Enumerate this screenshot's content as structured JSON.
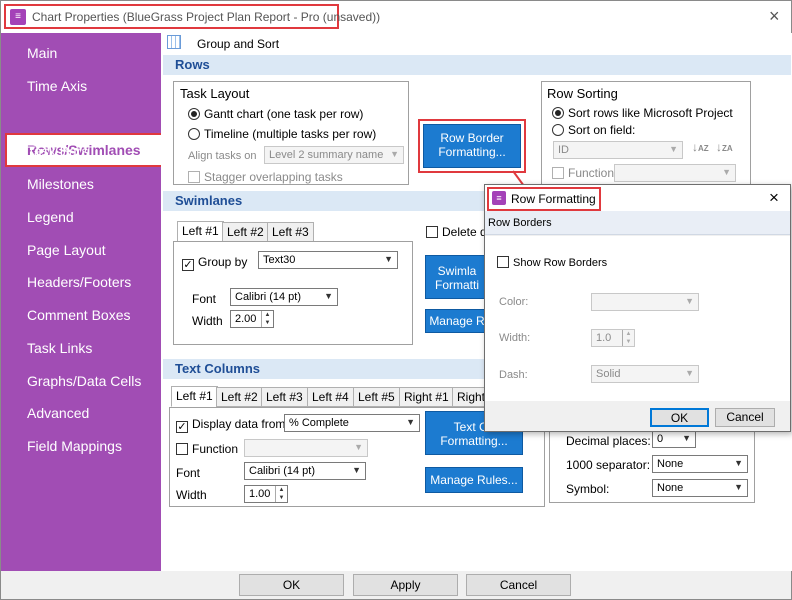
{
  "window": {
    "title": "Chart Properties (BlueGrass Project Plan Report - Pro (unsaved))",
    "close_glyph": "×",
    "icon": "app-icon"
  },
  "sidebar": {
    "items": [
      {
        "label": "Main"
      },
      {
        "label": "Time Axis"
      },
      {
        "label": "Rows/Swimlanes",
        "selected": true
      },
      {
        "label": "Task Bars"
      },
      {
        "label": "Milestones"
      },
      {
        "label": "Legend"
      },
      {
        "label": "Page Layout"
      },
      {
        "label": "Headers/Footers"
      },
      {
        "label": "Comment Boxes"
      },
      {
        "label": "Task Links"
      },
      {
        "label": "Graphs/Data Cells"
      },
      {
        "label": "Advanced"
      },
      {
        "label": "Field Mappings"
      }
    ],
    "bg_color": "#a14db4"
  },
  "toolbar": {
    "group_sort_label": "Group and Sort",
    "icon": "calendar-grid-icon"
  },
  "rows": {
    "header": "Rows",
    "task_layout": {
      "title": "Task Layout",
      "gantt_label": "Gantt chart (one task per row)",
      "timeline_label": "Timeline (multiple tasks per row)",
      "align_label": "Align tasks on",
      "align_value": "Level 2 summary name",
      "stagger_label": "Stagger overlapping tasks"
    },
    "border_button": {
      "line1": "Row Border",
      "line2": "Formatting..."
    },
    "sorting": {
      "title": "Row Sorting",
      "sort_ms_label": "Sort rows like Microsoft Project",
      "sort_field_label": "Sort on field:",
      "field_value": "ID",
      "function_label": "Function",
      "function_value": ""
    }
  },
  "swimlanes": {
    "header": "Swimlanes",
    "tabs": [
      "Left #1",
      "Left #2",
      "Left #3"
    ],
    "group_by_label": "Group by",
    "group_by_value": "Text30",
    "font_label": "Font",
    "font_value": "Calibri (14 pt)",
    "width_label": "Width",
    "width_value": "2.00",
    "delete_label": "Delete d",
    "swimlane_button": {
      "line1": "Swimla",
      "line2": "Formatti"
    },
    "manage_button": "Manage R"
  },
  "text_columns": {
    "header": "Text Columns",
    "tabs": [
      "Left #1",
      "Left #2",
      "Left #3",
      "Left #4",
      "Left #5",
      "Right #1",
      "Right"
    ],
    "display_label": "Display data from",
    "display_value": "% Complete",
    "function_label": "Function",
    "function_value": "",
    "font_label": "Font",
    "font_value": "Calibri (14 pt)",
    "width_label": "Width",
    "width_value": "1.00",
    "text_button": {
      "line1": "Text Co",
      "line2": "Formatting..."
    },
    "manage_button": "Manage Rules...",
    "decimal_label": "Decimal places:",
    "decimal_value": "0",
    "separator_label": "1000 separator:",
    "separator_value": "None",
    "symbol_label": "Symbol:",
    "symbol_value": "None"
  },
  "footer": {
    "ok": "OK",
    "apply": "Apply",
    "cancel": "Cancel"
  },
  "row_formatting_dialog": {
    "title": "Row Formatting",
    "section": "Row Borders",
    "show_label": "Show Row Borders",
    "color_label": "Color:",
    "width_label": "Width:",
    "width_value": "1.0",
    "dash_label": "Dash:",
    "dash_value": "Solid",
    "ok": "OK",
    "cancel": "Cancel",
    "close_glyph": "×"
  },
  "colors": {
    "accent_blue": "#1c7bd0",
    "highlight_red": "#e0393e",
    "header_band": "#dbe8f5"
  }
}
